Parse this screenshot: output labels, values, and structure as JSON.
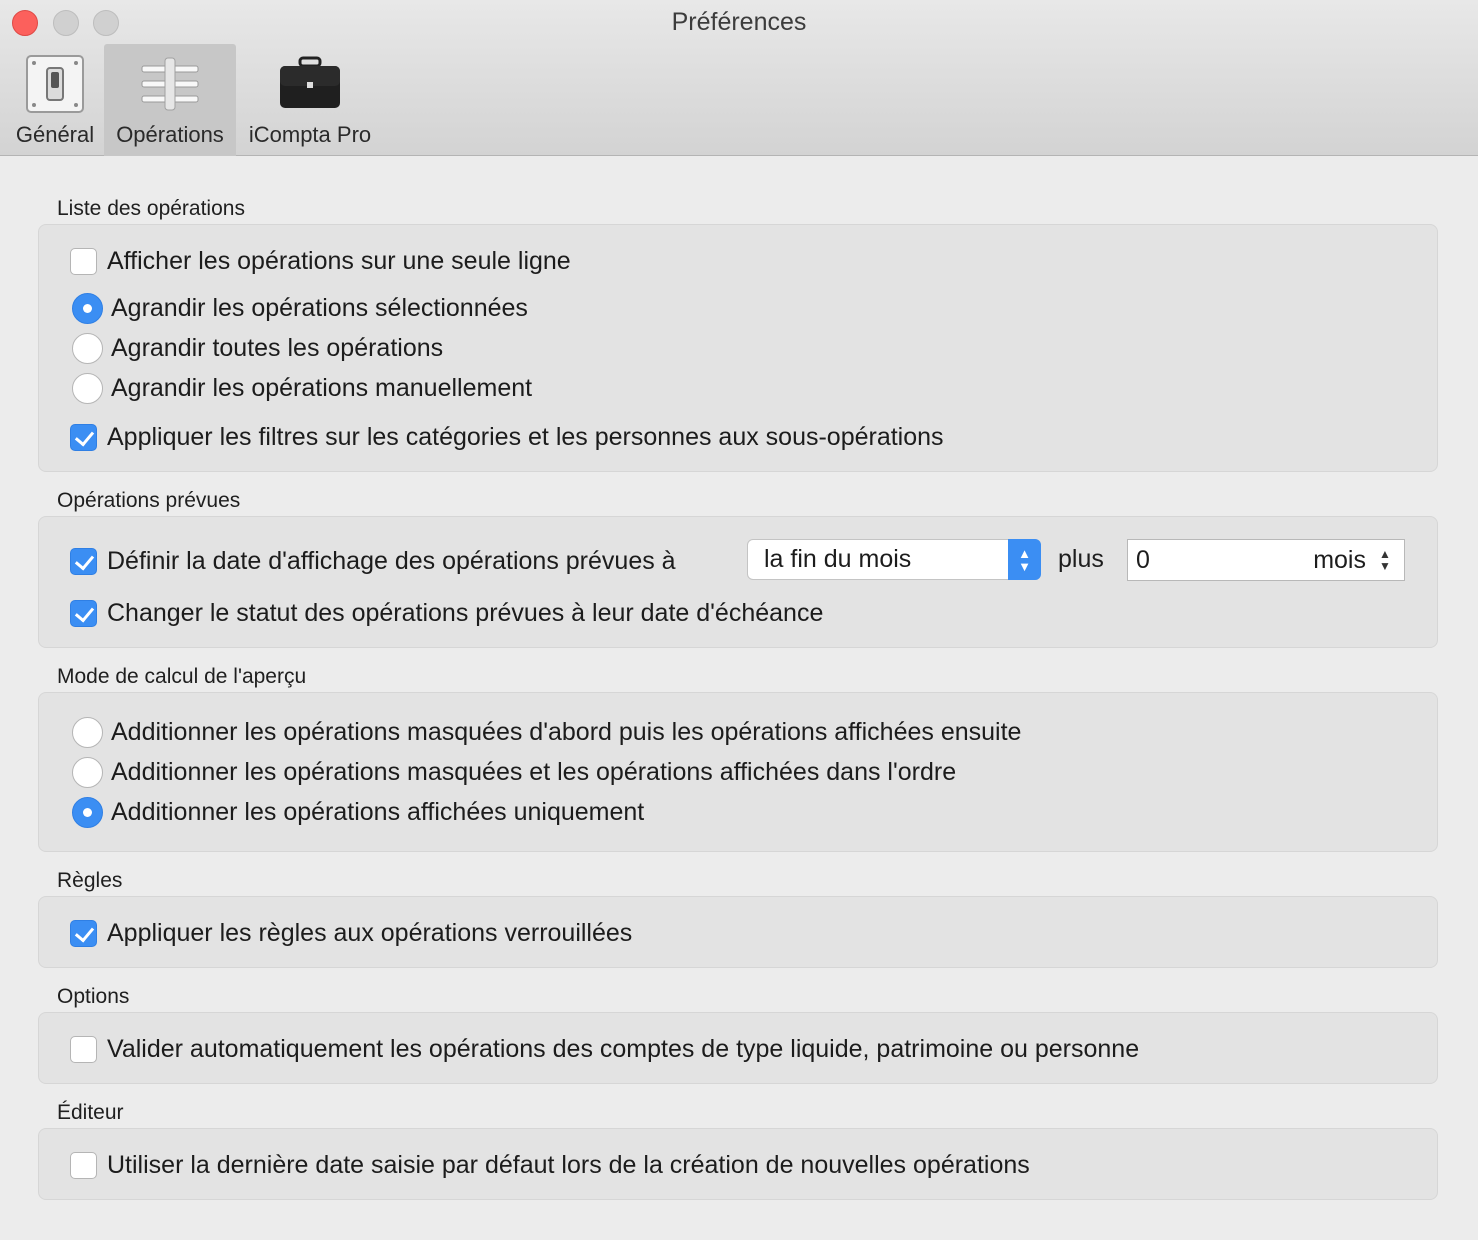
{
  "window": {
    "title": "Préférences"
  },
  "toolbar": {
    "tabs": [
      {
        "label": "Général",
        "icon": "switch-icon"
      },
      {
        "label": "Opérations",
        "icon": "sliders-icon",
        "active": true
      },
      {
        "label": "iCompta Pro",
        "icon": "briefcase-icon"
      }
    ]
  },
  "sections": {
    "list": {
      "title": "Liste des opérations",
      "single_line": "Afficher les opérations sur une seule ligne",
      "expand_selected": "Agrandir les opérations sélectionnées",
      "expand_all": "Agrandir toutes les opérations",
      "expand_manual": "Agrandir les opérations manuellement",
      "apply_filters": "Appliquer les filtres sur les catégories et les personnes aux sous-opérations"
    },
    "scheduled": {
      "title": "Opérations prévues",
      "define_date": "Définir la date d'affichage des opérations prévues à",
      "date_option": "la fin du mois",
      "plus_label": "plus",
      "offset_value": "0",
      "offset_unit": "mois",
      "change_status": "Changer le statut des opérations prévues à leur date d'échéance"
    },
    "preview": {
      "title": "Mode de calcul de l'aperçu",
      "hidden_first": "Additionner les opérations masquées d'abord puis les opérations affichées ensuite",
      "in_order": "Additionner les opérations masquées et les opérations affichées dans l'ordre",
      "displayed_only": "Additionner les opérations affichées uniquement"
    },
    "rules": {
      "title": "Règles",
      "apply_locked": "Appliquer les règles aux opérations verrouillées"
    },
    "options": {
      "title": "Options",
      "auto_validate": "Valider automatiquement les opérations des comptes de type liquide, patrimoine ou personne"
    },
    "editor": {
      "title": "Éditeur",
      "last_date": "Utiliser la dernière date saisie par défaut lors de la création de nouvelles opérations"
    }
  },
  "colors": {
    "accent": "#3b8ef3",
    "close": "#fc605c"
  }
}
